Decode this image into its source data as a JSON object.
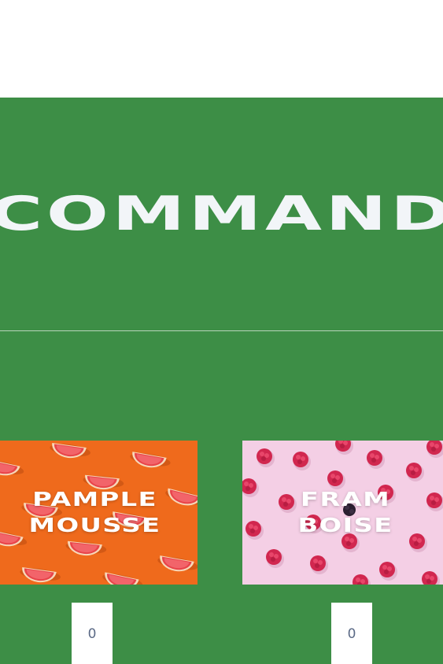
{
  "page": {
    "heading": "COMMANDER"
  },
  "products": [
    {
      "label_line1": "PAMPLE",
      "label_line2": "MOUSSE",
      "image": "grapefruit-slices-photo",
      "quantity": "0"
    },
    {
      "label_line1": "FRAM",
      "label_line2": "BOISE",
      "image": "raspberries-photo",
      "quantity": "0"
    }
  ],
  "colors": {
    "section_background": "#3d8e46",
    "heading_text": "#f2f5f8",
    "grapefruit_background": "#ef6a1c",
    "raspberry_background": "#f4cfe5"
  }
}
